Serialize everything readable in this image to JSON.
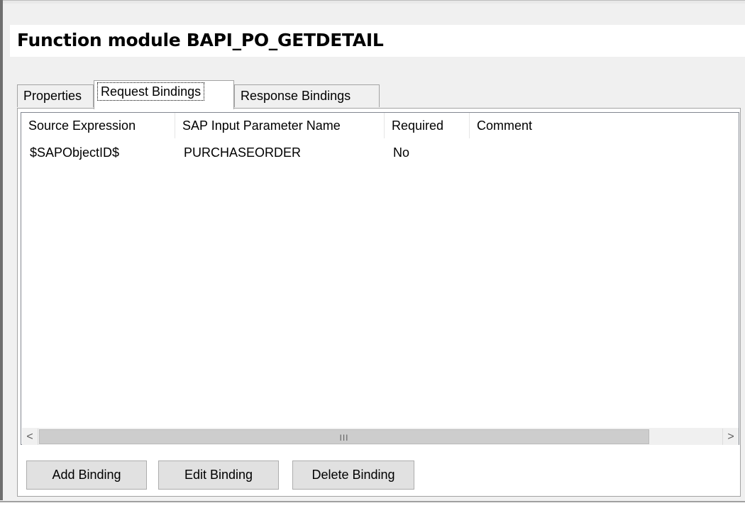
{
  "header": {
    "title": "Function module BAPI_PO_GETDETAIL"
  },
  "tabs": [
    {
      "label": "Properties",
      "active": false
    },
    {
      "label": "Request Bindings",
      "active": true
    },
    {
      "label": "Response Bindings",
      "active": false
    }
  ],
  "grid": {
    "columns": [
      "Source Expression",
      "SAP Input Parameter Name",
      "Required",
      "Comment"
    ],
    "rows": [
      {
        "source_expression": "$SAPObjectID$",
        "sap_input_parameter_name": "PURCHASEORDER",
        "required": "No",
        "comment": ""
      }
    ],
    "scrollbar": {
      "grip": "III",
      "left_arrow": "<",
      "right_arrow": ">"
    }
  },
  "buttons": {
    "add": "Add Binding",
    "edit": "Edit Binding",
    "delete": "Delete Binding"
  }
}
